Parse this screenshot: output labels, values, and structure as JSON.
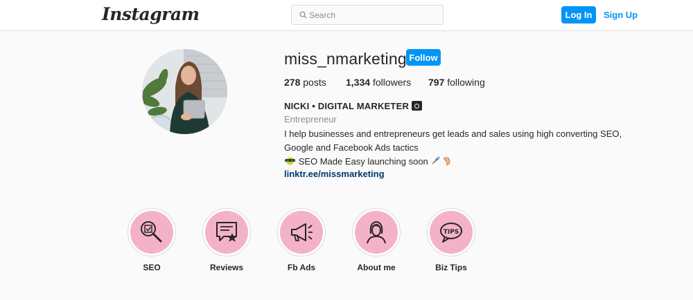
{
  "header": {
    "logo_text": "Instagram",
    "search_placeholder": "Search",
    "login_label": "Log In",
    "signup_label": "Sign Up"
  },
  "profile": {
    "username": "miss_nmarketing",
    "follow_label": "Follow",
    "posts_count": "278",
    "posts_label": "posts",
    "followers_count": "1,334",
    "followers_label": "followers",
    "following_count": "797",
    "following_label": "following",
    "full_name": "NICKI • DIGITAL MARKETER",
    "category": "Entrepreneur",
    "bio_line1": "I help businesses and entrepreneurs get leads and sales using high converting SEO,",
    "bio_line2": "Google and Facebook Ads tactics",
    "bio_line3": "SEO Made Easy launching soon",
    "link": "linktr.ee/missmarketing"
  },
  "highlights": [
    {
      "label": "SEO",
      "icon": "magnifier-checklist-icon"
    },
    {
      "label": "Reviews",
      "icon": "review-star-icon"
    },
    {
      "label": "Fb Ads",
      "icon": "megaphone-icon"
    },
    {
      "label": "About me",
      "icon": "woman-portrait-icon"
    },
    {
      "label": "Biz Tips",
      "icon": "tips-bubble-icon"
    }
  ],
  "colors": {
    "accent": "#0095f6",
    "highlight_fill": "#f4b2c9",
    "link": "#00376b"
  }
}
